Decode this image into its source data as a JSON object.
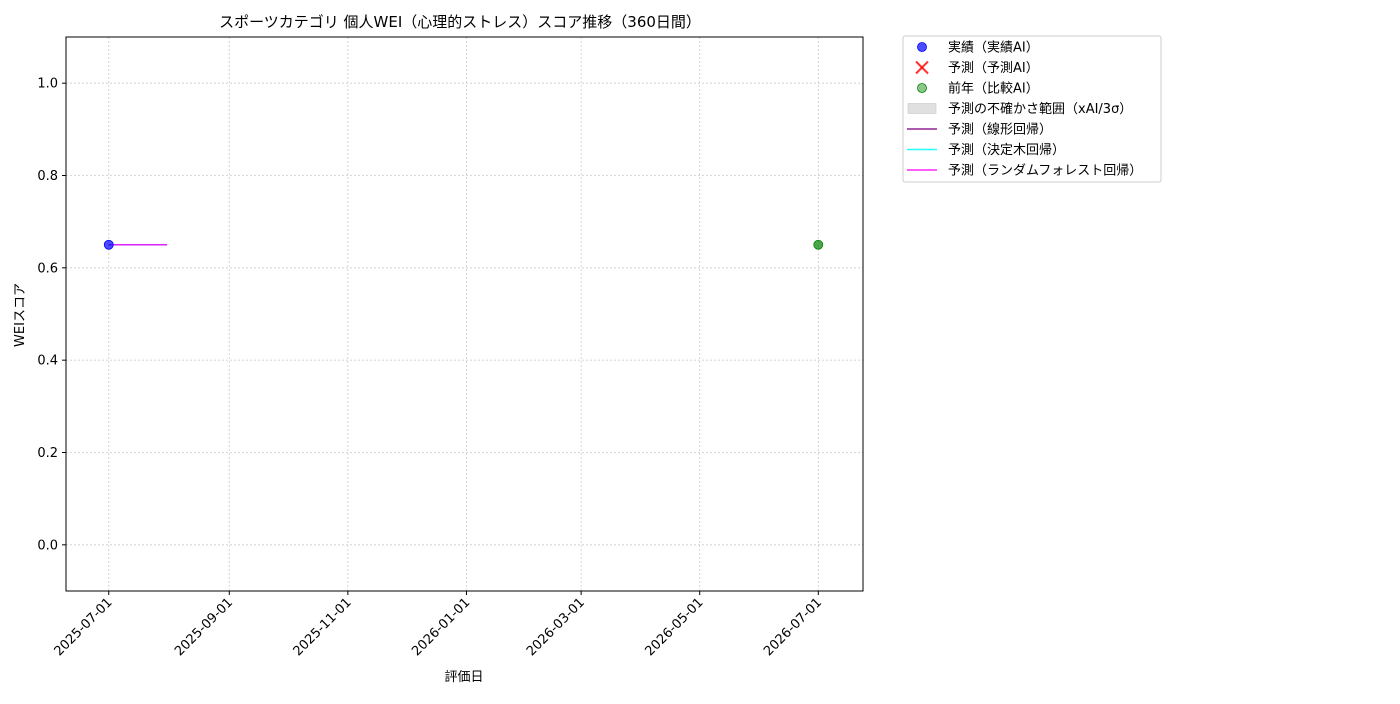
{
  "chart_data": {
    "type": "scatter",
    "title": "スポーツカテゴリ 個人WEI（心理的ストレス）スコア推移（360日間）",
    "xlabel": "評価日",
    "ylabel": "WEIスコア",
    "x_axis_type": "date",
    "xlim": [
      "2025-06-09",
      "2026-07-24"
    ],
    "ylim": [
      -0.1,
      1.1
    ],
    "x_ticks": [
      "2025-07-01",
      "2025-09-01",
      "2025-11-01",
      "2026-01-01",
      "2026-03-01",
      "2026-05-01",
      "2026-07-01"
    ],
    "y_ticks": [
      0.0,
      0.2,
      0.4,
      0.6,
      0.8,
      1.0
    ],
    "y_tick_labels": [
      "0.0",
      "0.2",
      "0.4",
      "0.6",
      "0.8",
      "1.0"
    ],
    "grid": true,
    "legend_position": "outside-upper-right",
    "series": [
      {
        "name": "実績（実績AI）",
        "kind": "scatter",
        "marker": "circle",
        "color": "#0000ff",
        "points": [
          {
            "x": "2025-07-01",
            "y": 0.65
          }
        ]
      },
      {
        "name": "予測（予測AI）",
        "kind": "scatter",
        "marker": "x",
        "color": "#ff0000",
        "points": []
      },
      {
        "name": "前年（比較AI）",
        "kind": "scatter",
        "marker": "circle",
        "color": "#008000",
        "points": [
          {
            "x": "2026-07-01",
            "y": 0.65
          }
        ]
      },
      {
        "name": "予測の不確かさ範囲（xAI/3σ）",
        "kind": "band",
        "color": "#d3d3d3",
        "points": []
      },
      {
        "name": "予測（線形回帰）",
        "kind": "line",
        "color": "#800080",
        "points": [
          {
            "x": "2025-07-01",
            "y": 0.65
          },
          {
            "x": "2025-07-31",
            "y": 0.65
          }
        ]
      },
      {
        "name": "予測（決定木回帰）",
        "kind": "line",
        "color": "#00ffff",
        "points": [
          {
            "x": "2025-07-01",
            "y": 0.65
          },
          {
            "x": "2025-07-31",
            "y": 0.65
          }
        ]
      },
      {
        "name": "予測（ランダムフォレスト回帰）",
        "kind": "line",
        "color": "#ff00ff",
        "points": [
          {
            "x": "2025-07-01",
            "y": 0.65
          },
          {
            "x": "2025-07-31",
            "y": 0.65
          }
        ]
      }
    ]
  }
}
